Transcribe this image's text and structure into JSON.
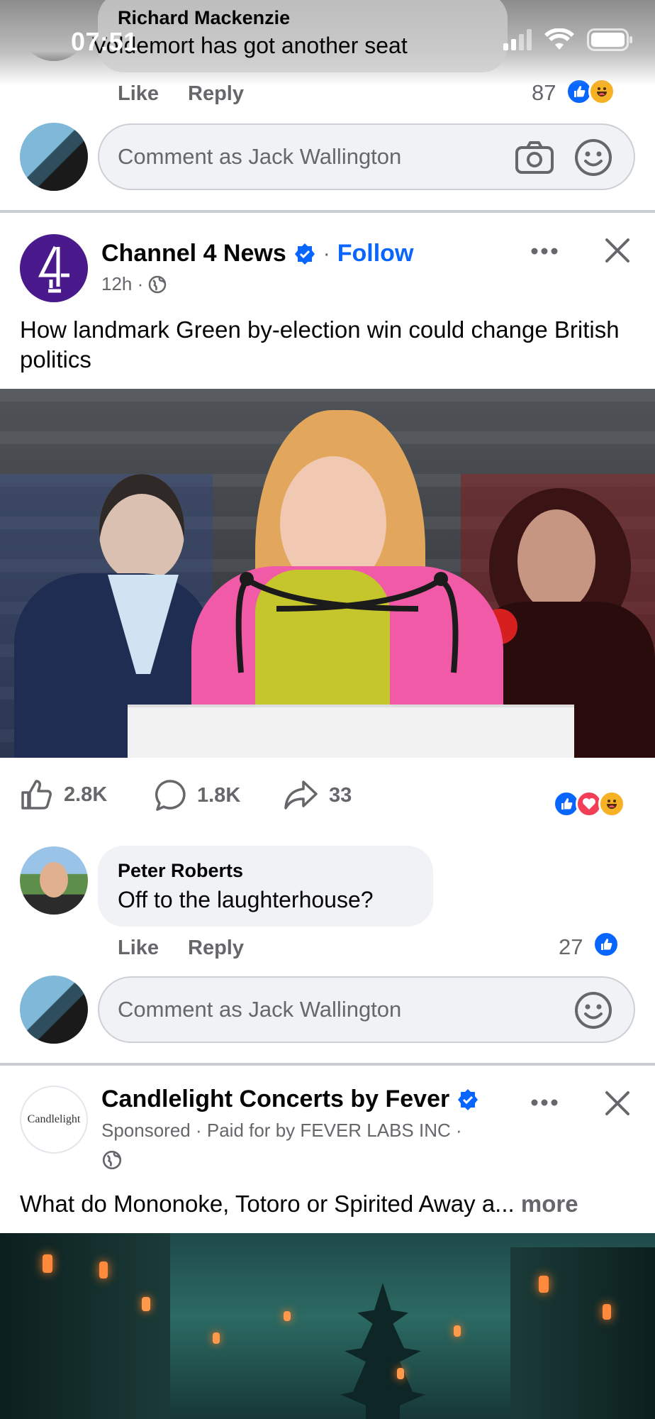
{
  "status_bar": {
    "time": "07:51"
  },
  "top_comment": {
    "author": "Richard Mackenzie",
    "text": "Voldemort  has got another seat",
    "like_label": "Like",
    "reply_label": "Reply",
    "reaction_count": "87"
  },
  "comment_box_1": {
    "placeholder": "Comment as Jack Wallington"
  },
  "post": {
    "page_name": "Channel 4 News",
    "follow_label": "Follow",
    "separator": "·",
    "time": "12h ·",
    "text": "How landmark Green by-election win could change British politics",
    "likes": "2.8K",
    "comments": "1.8K",
    "shares": "33"
  },
  "post_comment": {
    "author": "Peter Roberts",
    "text": "Off to the laughterhouse?",
    "like_label": "Like",
    "reply_label": "Reply",
    "reaction_count": "27"
  },
  "comment_box_2": {
    "placeholder": "Comment as Jack Wallington"
  },
  "ad": {
    "page_name": "Candlelight Concerts by Fever",
    "logo_text": "Candlelight",
    "meta": "Sponsored · Paid for by FEVER LABS INC ·",
    "text": "What do Mononoke, Totoro or Spirited Away a...",
    "more_label": "more"
  },
  "colors": {
    "accent": "#0866ff",
    "channel4_purple": "#4a1a8c",
    "like_blue": "#0866ff",
    "love_red": "#f33e58",
    "haha_yellow": "#f7b125"
  },
  "icons": [
    "camera-icon",
    "smiley-icon",
    "verified-icon",
    "globe-icon",
    "more-icon",
    "close-icon",
    "like-icon",
    "comment-icon",
    "share-icon"
  ]
}
